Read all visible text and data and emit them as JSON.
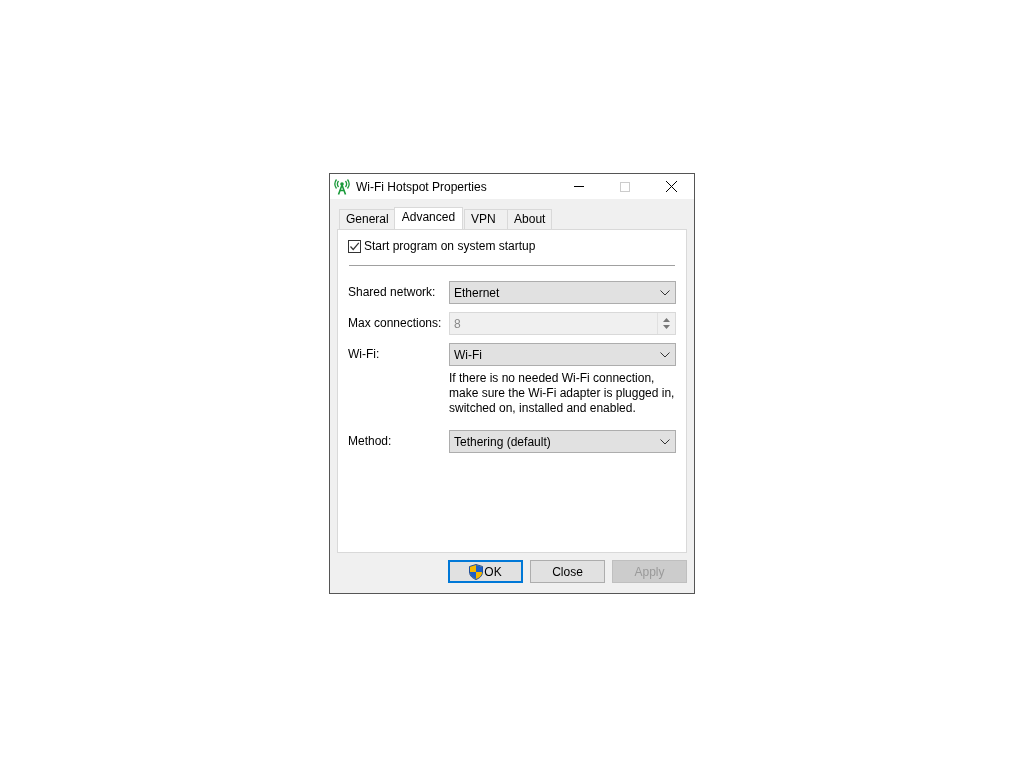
{
  "window": {
    "title": "Wi-Fi Hotspot Properties"
  },
  "tabs": [
    {
      "label": "General",
      "selected": false
    },
    {
      "label": "Advanced",
      "selected": true
    },
    {
      "label": "VPN",
      "selected": false
    },
    {
      "label": "About",
      "selected": false
    }
  ],
  "startup": {
    "label": "Start program on system startup",
    "checked": true
  },
  "rows": [
    {
      "kind": "dropdown",
      "label": "Shared network:",
      "value": "Ethernet",
      "disabled": false
    },
    {
      "kind": "spinner",
      "label": "Max connections:",
      "value": "8",
      "disabled": true
    },
    {
      "kind": "dropdown",
      "label": "Wi-Fi:",
      "value": "Wi-Fi",
      "disabled": false,
      "note": "If there is no needed Wi-Fi connection, make sure the Wi-Fi adapter is plugged in, switched on, installed and enabled."
    },
    {
      "kind": "dropdown",
      "label": "Method:",
      "value": "Tethering (default)",
      "disabled": false
    }
  ],
  "buttons": [
    {
      "label": "OK",
      "default": true,
      "shield": true,
      "disabled": false
    },
    {
      "label": "Close",
      "default": false,
      "shield": false,
      "disabled": false
    },
    {
      "label": "Apply",
      "default": false,
      "shield": false,
      "disabled": true
    }
  ]
}
